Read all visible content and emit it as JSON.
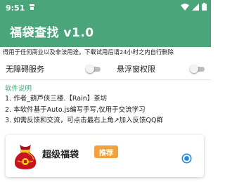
{
  "status_bar": {
    "time": "9:51",
    "notification_icon": "app-notification-icon",
    "icons": [
      "wifi-icon",
      "signal-icon",
      "battery-icon"
    ]
  },
  "app_bar": {
    "title": "福袋查找 v1.0"
  },
  "notice": "得用于任何商业以及非法用途，下载试用后请24小时之内自行删除",
  "settings": {
    "accessibility": {
      "label": "无障碍服务",
      "enabled": false
    },
    "floating_window": {
      "label": "悬浮窗权限",
      "enabled": false
    }
  },
  "description": {
    "title": "软件说明",
    "lines": [
      "1. 作者_葫芦侠三楼.【Rain】茶坊",
      "2. 本软件基于Auto.js编写手写,仅用于交流学习",
      "3. 如需反馈和交流，可点击最右上角↗加入反馈QQ群"
    ]
  },
  "option_card": {
    "title": "超级福袋",
    "badge": "推荐",
    "selected": true
  },
  "colors": {
    "primary": "#4aa57a",
    "badge": "#f0a23c",
    "radio": "#1e88e5",
    "bag_red": "#c8141e"
  }
}
